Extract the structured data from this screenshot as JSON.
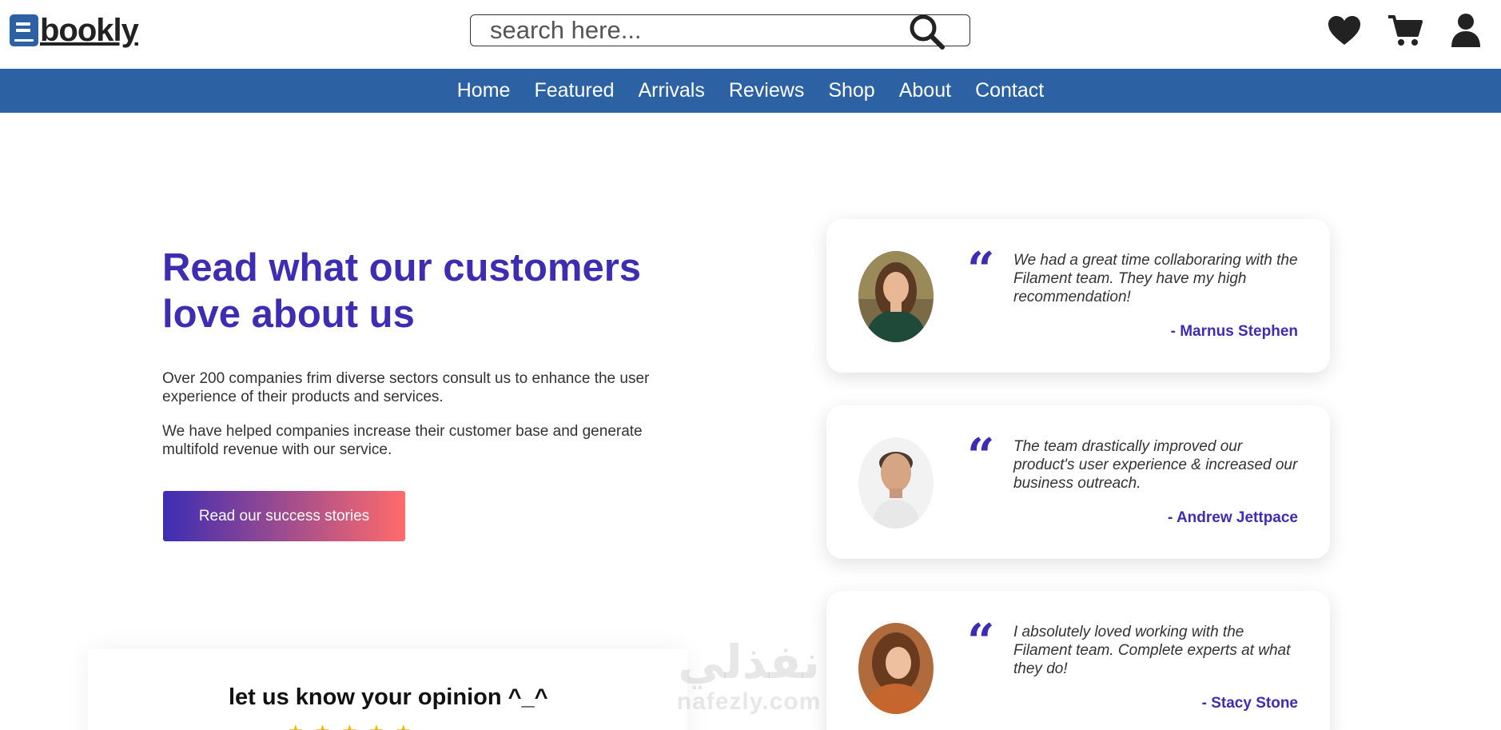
{
  "header": {
    "logo_text": "bookly",
    "search_placeholder": "search here..."
  },
  "nav": {
    "items": [
      "Home",
      "Featured",
      "Arrivals",
      "Reviews",
      "Shop",
      "About",
      "Contact"
    ]
  },
  "hero": {
    "title": "Read what our customers love about us",
    "paragraph1": "Over 200 companies frim diverse sectors consult us to enhance the user experience of their products and services.",
    "paragraph2": "We have helped companies increase their customer base and generate multifold revenue with our service.",
    "cta_label": "Read our success stories"
  },
  "testimonials": [
    {
      "quote": "We had a great time collaboraring with the Filament team. They have my high recommendation!",
      "author": "- Marnus Stephen"
    },
    {
      "quote": "The team drastically improved our product's user experience & increased our business outreach.",
      "author": "- Andrew Jettpace"
    },
    {
      "quote": "I absolutely loved working with the Filament team. Complete experts at what they do!",
      "author": "- Stacy Stone"
    }
  ],
  "opinion": {
    "title": "let us know your opinion ^_^",
    "rating": 5
  },
  "watermark": {
    "arabic": "نفذلي",
    "latin": "nafezly.com"
  },
  "colors": {
    "brand_blue": "#2c62a4",
    "accent_purple": "#3d2db3",
    "gradient_end": "#ff6b6b"
  }
}
